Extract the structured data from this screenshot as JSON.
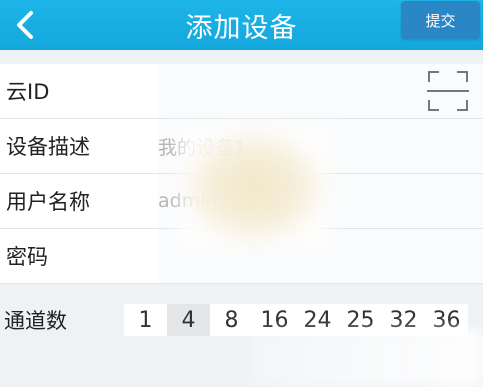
{
  "header": {
    "title": "添加设备",
    "submit_label": "提交",
    "back_icon": "chevron-left-icon",
    "color": "#1eb5e8",
    "submit_color": "#2a86c4"
  },
  "form": {
    "cloud_id": {
      "label": "云ID",
      "value": "",
      "icon": "scan-icon"
    },
    "description": {
      "label": "设备描述",
      "placeholder": "我的设备1"
    },
    "username": {
      "label": "用户名称",
      "value": "admin"
    },
    "password": {
      "label": "密码",
      "value": ""
    }
  },
  "channels": {
    "label": "通道数",
    "options": [
      "1",
      "4",
      "8",
      "16",
      "24",
      "25",
      "32",
      "36"
    ],
    "selected": "4"
  }
}
